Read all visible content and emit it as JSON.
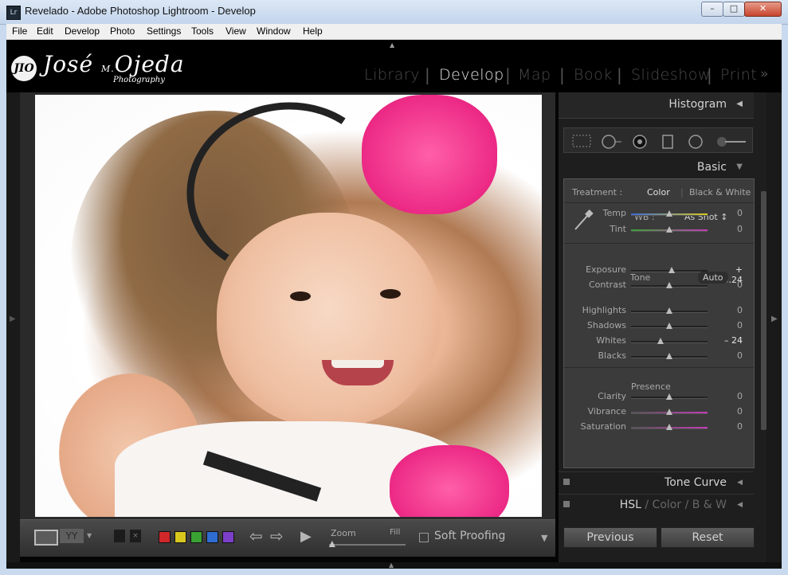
{
  "window": {
    "title": "Revelado - Adobe Photoshop Lightroom - Develop",
    "app_icon": "Lr"
  },
  "menu": [
    "File",
    "Edit",
    "Develop",
    "Photo",
    "Settings",
    "Tools",
    "View",
    "Window",
    "Help"
  ],
  "identity_plate": {
    "mark": "JIO",
    "name": "José",
    "name2": "Ojeda",
    "sub": "Photography",
    "initial": "M."
  },
  "modules": [
    "Library",
    "Develop",
    "Map",
    "Book",
    "Slideshow",
    "Print"
  ],
  "active_module": "Develop",
  "toolbar": {
    "view_ba": "YY",
    "color_labels": [
      "#d0272b",
      "#d8c81e",
      "#3aa232",
      "#2f6cd0",
      "#7b3fc8"
    ],
    "zoom_label": "Zoom",
    "fill_label": "Fill",
    "zoom_level": 0.04,
    "soft_proofing": "Soft Proofing"
  },
  "panels": {
    "histogram": "Histogram",
    "basic": "Basic",
    "treatment_label": "Treatment :",
    "treatment_color": "Color",
    "treatment_bw": "Black & White",
    "wb_label": "WB :",
    "wb_value": "As Shot",
    "tone_label": "Tone",
    "auto": "Auto",
    "presence_label": "Presence",
    "tone_curve": "Tone Curve",
    "hsl": "HSL",
    "color": "Color",
    "bw": "B & W"
  },
  "sliders": [
    {
      "label": "Temp",
      "value": "0",
      "pos": 0.5
    },
    {
      "label": "Tint",
      "value": "0",
      "pos": 0.5
    },
    {
      "label": "Exposure",
      "value": "+ 0.24",
      "pos": 0.53
    },
    {
      "label": "Contrast",
      "value": "0",
      "pos": 0.5
    },
    {
      "label": "Highlights",
      "value": "0",
      "pos": 0.5
    },
    {
      "label": "Shadows",
      "value": "0",
      "pos": 0.5
    },
    {
      "label": "Whites",
      "value": "– 24",
      "pos": 0.39
    },
    {
      "label": "Blacks",
      "value": "0",
      "pos": 0.5
    },
    {
      "label": "Clarity",
      "value": "0",
      "pos": 0.5
    },
    {
      "label": "Vibrance",
      "value": "0",
      "pos": 0.5
    },
    {
      "label": "Saturation",
      "value": "0",
      "pos": 0.5
    }
  ],
  "buttons": {
    "previous": "Previous",
    "reset": "Reset"
  },
  "icons": [
    "crop-overlay-icon",
    "spot-removal-icon",
    "red-eye-icon",
    "graduated-filter-icon",
    "radial-filter-icon",
    "adjustment-brush-icon",
    "eyedropper-icon"
  ]
}
